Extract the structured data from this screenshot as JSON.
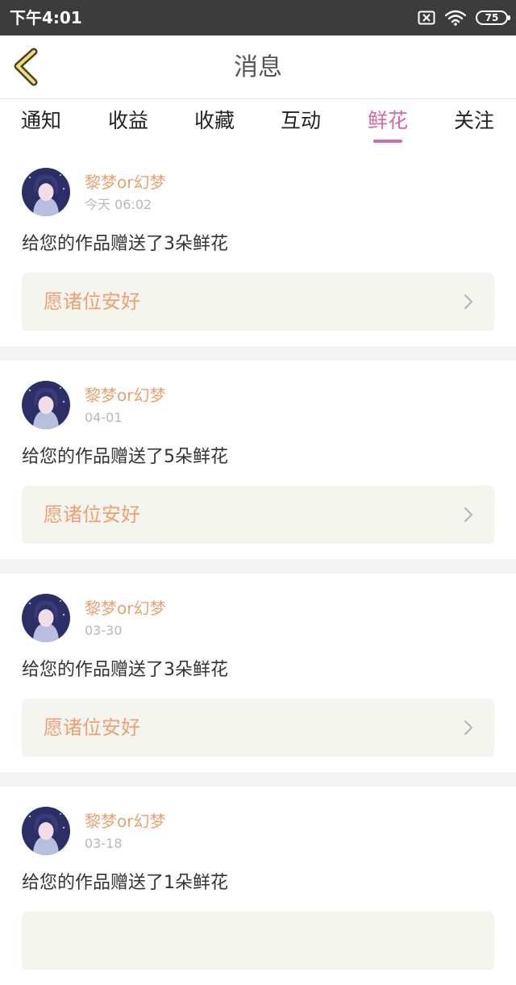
{
  "status_bar": {
    "time": "下午4:01",
    "battery": "75",
    "icons": [
      "sim-off-icon",
      "wifi-icon",
      "battery-icon"
    ]
  },
  "header": {
    "title": "消息",
    "back_icon": "chevron-left-icon"
  },
  "tabs": [
    {
      "label": "通知",
      "active": false
    },
    {
      "label": "收益",
      "active": false
    },
    {
      "label": "收藏",
      "active": false
    },
    {
      "label": "互动",
      "active": false
    },
    {
      "label": "鲜花",
      "active": true
    },
    {
      "label": "关注",
      "active": false
    }
  ],
  "colors": {
    "accent": "#d46aa7",
    "username": "#f0a070",
    "note_background": "#f5f5f0",
    "status_bar": "#3c3c3c"
  },
  "messages": [
    {
      "username": "黎梦or幻梦",
      "time": "今天 06:02",
      "text": "给您的作品赠送了3朵鲜花",
      "note": "愿诸位安好"
    },
    {
      "username": "黎梦or幻梦",
      "time": "04-01",
      "text": "给您的作品赠送了5朵鲜花",
      "note": "愿诸位安好"
    },
    {
      "username": "黎梦or幻梦",
      "time": "03-30",
      "text": "给您的作品赠送了3朵鲜花",
      "note": "愿诸位安好"
    },
    {
      "username": "黎梦or幻梦",
      "time": "03-18",
      "text": "给您的作品赠送了1朵鲜花",
      "note": ""
    }
  ]
}
